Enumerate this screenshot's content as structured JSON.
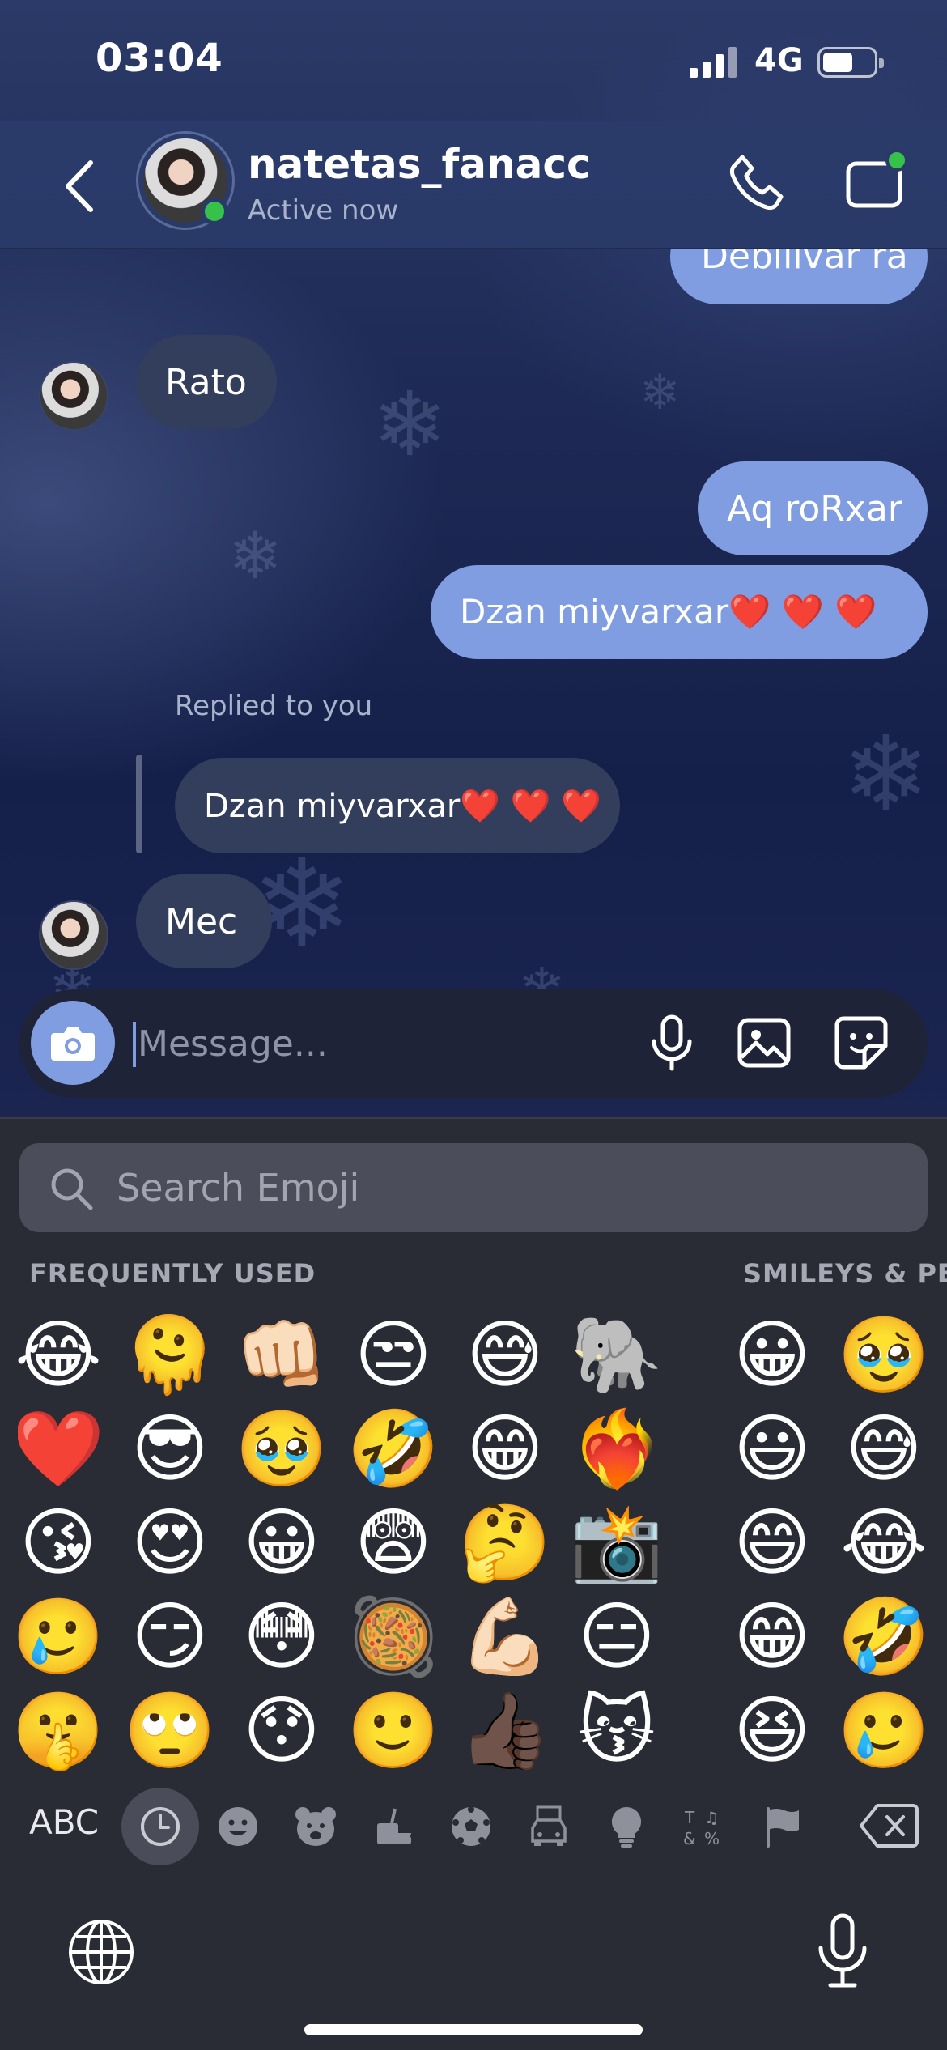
{
  "status_bar": {
    "time": "03:04",
    "network": "4G"
  },
  "header": {
    "contact_name": "natetas_fanacc",
    "contact_status": "Active now"
  },
  "messages": [
    {
      "text": "Debilivar ra",
      "direction": "out"
    },
    {
      "text": "Rato",
      "direction": "in"
    },
    {
      "text": "Aq roRxar",
      "direction": "out"
    },
    {
      "text": "Dzan miyvarxar❤️ ❤️ ❤️",
      "direction": "out"
    },
    {
      "text": "Dzan miyvarxar❤️ ❤️ ❤️",
      "direction": "in",
      "reply_label": "Replied to you"
    },
    {
      "text": "Mec",
      "direction": "in"
    }
  ],
  "composer": {
    "placeholder": "Message..."
  },
  "keyboard": {
    "search_placeholder": "Search Emoji",
    "section_frequent": "FREQUENTLY USED",
    "section_smileys": "SMILEYS & PE",
    "abc_label": "ABC",
    "frequent_emoji": [
      [
        "😂",
        "🫠",
        "👊🏻",
        "😒",
        "😅",
        "🐘"
      ],
      [
        "❤️",
        "😎",
        "🥹",
        "🤣",
        "😁",
        "❤️‍🔥"
      ],
      [
        "😘",
        "😍",
        "😀",
        "😨",
        "🤔",
        "📸"
      ],
      [
        "🥲",
        "😏",
        "😳",
        "🥘",
        "💪🏻",
        "😑"
      ],
      [
        "🤫",
        "🙄",
        "😯",
        "🙂",
        "👍🏿",
        "😽"
      ]
    ],
    "smiley_emoji": [
      [
        "😀",
        "🥹"
      ],
      [
        "😃",
        "😅"
      ],
      [
        "😄",
        "😂"
      ],
      [
        "😁",
        "🤣"
      ],
      [
        "😆",
        "🥲"
      ]
    ],
    "categories": [
      "recent-icon",
      "smiley-icon",
      "animal-icon",
      "food-icon",
      "activity-icon",
      "travel-icon",
      "objects-icon",
      "symbols-icon",
      "flags-icon"
    ]
  },
  "colors": {
    "outgoing_bubble": "#7f9de0",
    "incoming_bubble": "#333d5c",
    "online": "#36c24a",
    "header": "#293a68"
  }
}
